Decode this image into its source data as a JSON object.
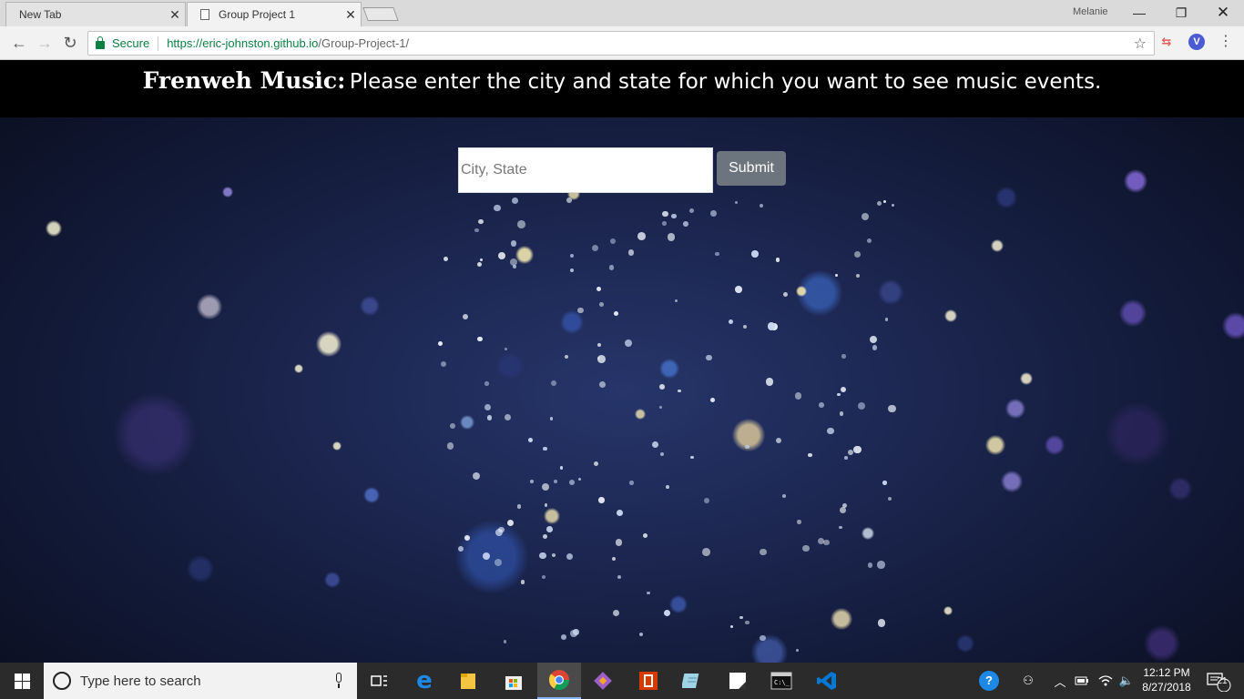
{
  "browser": {
    "tabs": [
      {
        "title": "New Tab"
      },
      {
        "title": "Group Project 1"
      }
    ],
    "profile_name": "Melanie",
    "secure_label": "Secure",
    "url_host": "https://eric-johnston.github.io",
    "url_path": "/Group-Project-1/"
  },
  "page": {
    "brand": "Frenweh Music:",
    "prompt": "Please enter the city and state for which you want to see music events.",
    "input_placeholder": "City, State",
    "submit_label": "Submit"
  },
  "taskbar": {
    "search_placeholder": "Type here to search",
    "time": "12:12 PM",
    "date": "8/27/2018",
    "notification_count": "21",
    "apps": [
      "task-view",
      "edge",
      "file-explorer",
      "store",
      "chrome",
      "git",
      "office",
      "notepad",
      "sticky-notes",
      "terminal",
      "vscode"
    ]
  },
  "colors": {
    "secure_green": "#0b8043",
    "submit_bg": "#6c757d",
    "header_band": "#000000",
    "page_bg": "#1c2650"
  }
}
